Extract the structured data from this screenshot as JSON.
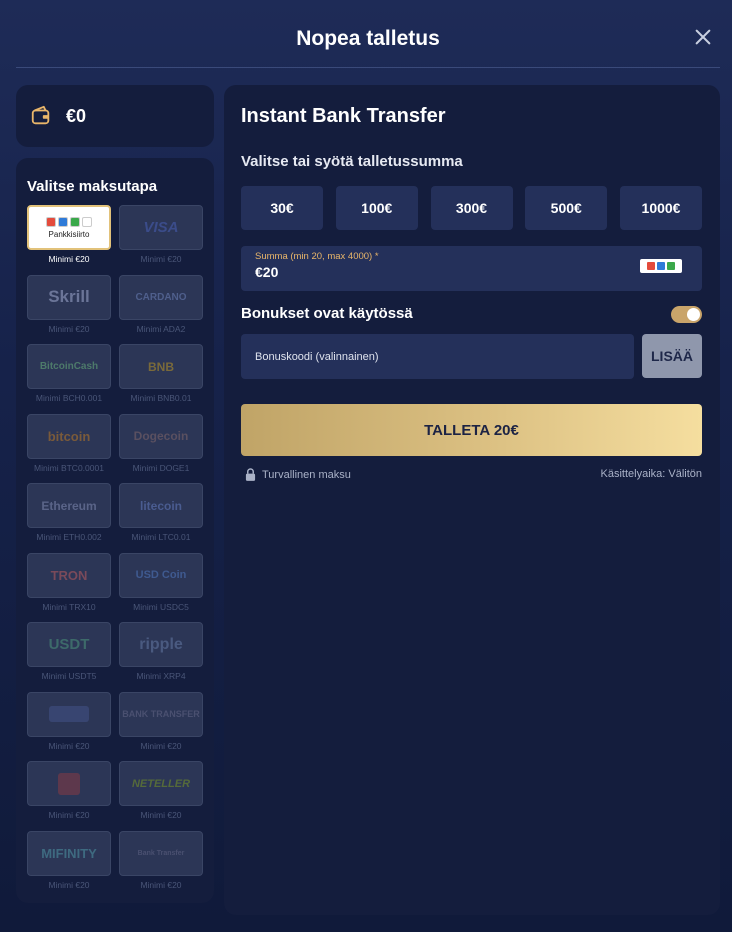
{
  "modal": {
    "title": "Nopea talletus"
  },
  "balance": {
    "amount": "€0"
  },
  "methods": {
    "title": "Valitse maksutapa",
    "items": [
      {
        "id": "pankkisiirto",
        "logo_text": "Pankkisiirto",
        "min": "Minimi €20",
        "selected": true
      },
      {
        "id": "visa",
        "logo_text": "VISA",
        "min": "Minimi €20",
        "selected": false
      },
      {
        "id": "skrill",
        "logo_text": "Skrill",
        "min": "Minimi €20",
        "selected": false
      },
      {
        "id": "cardano",
        "logo_text": "CARDANO",
        "min": "Minimi ADA2",
        "selected": false
      },
      {
        "id": "bitcoincash",
        "logo_text": "BitcoinCash",
        "min": "Minimi BCH0.001",
        "selected": false
      },
      {
        "id": "bnb",
        "logo_text": "BNB",
        "min": "Minimi BNB0.01",
        "selected": false
      },
      {
        "id": "bitcoin",
        "logo_text": "bitcoin",
        "min": "Minimi BTC0.0001",
        "selected": false
      },
      {
        "id": "dogecoin",
        "logo_text": "Dogecoin",
        "min": "Minimi DOGE1",
        "selected": false
      },
      {
        "id": "ethereum",
        "logo_text": "Ethereum",
        "min": "Minimi ETH0.002",
        "selected": false
      },
      {
        "id": "litecoin",
        "logo_text": "litecoin",
        "min": "Minimi LTC0.01",
        "selected": false
      },
      {
        "id": "tron",
        "logo_text": "TRON",
        "min": "Minimi TRX10",
        "selected": false
      },
      {
        "id": "usdcoin",
        "logo_text": "USD Coin",
        "min": "Minimi USDC5",
        "selected": false
      },
      {
        "id": "usdt",
        "logo_text": "USDT",
        "min": "Minimi USDT5",
        "selected": false
      },
      {
        "id": "ripple",
        "logo_text": "ripple",
        "min": "Minimi XRP4",
        "selected": false
      },
      {
        "id": "pay-n-play",
        "logo_text": "",
        "min": "Minimi €20",
        "selected": false
      },
      {
        "id": "bank-transfer",
        "logo_text": "BANK TRANSFER",
        "min": "Minimi €20",
        "selected": false
      },
      {
        "id": "siirto",
        "logo_text": "",
        "min": "Minimi €20",
        "selected": false
      },
      {
        "id": "neteller",
        "logo_text": "NETELLER",
        "min": "Minimi €20",
        "selected": false
      },
      {
        "id": "mifinity",
        "logo_text": "MIFINITY",
        "min": "Minimi €20",
        "selected": false
      },
      {
        "id": "bank-transfer-2",
        "logo_text": "Bank Transfer",
        "min": "Minimi €20",
        "selected": false
      }
    ]
  },
  "deposit": {
    "title": "Instant Bank Transfer",
    "amount_label": "Valitse tai syötä talletussumma",
    "quick_amounts": [
      "30€",
      "100€",
      "300€",
      "500€",
      "1000€"
    ],
    "amount_field_label": "Summa (min 20, max 4000) *",
    "amount_value": "€20",
    "bonus_label": "Bonukset ovat käytössä",
    "bonus_enabled": true,
    "bonus_placeholder": "Bonuskoodi (valinnainen)",
    "add_button": "LISÄÄ",
    "submit_button": "TALLETA 20€",
    "secure_text": "Turvallinen maksu",
    "processing_time": "Käsittelyaika: Välitön"
  },
  "colors": {
    "background": "#101a3a",
    "panel": "#141d3d",
    "field": "#24305a",
    "gold": "#dcc183",
    "accent_orange": "#e9b66a"
  }
}
